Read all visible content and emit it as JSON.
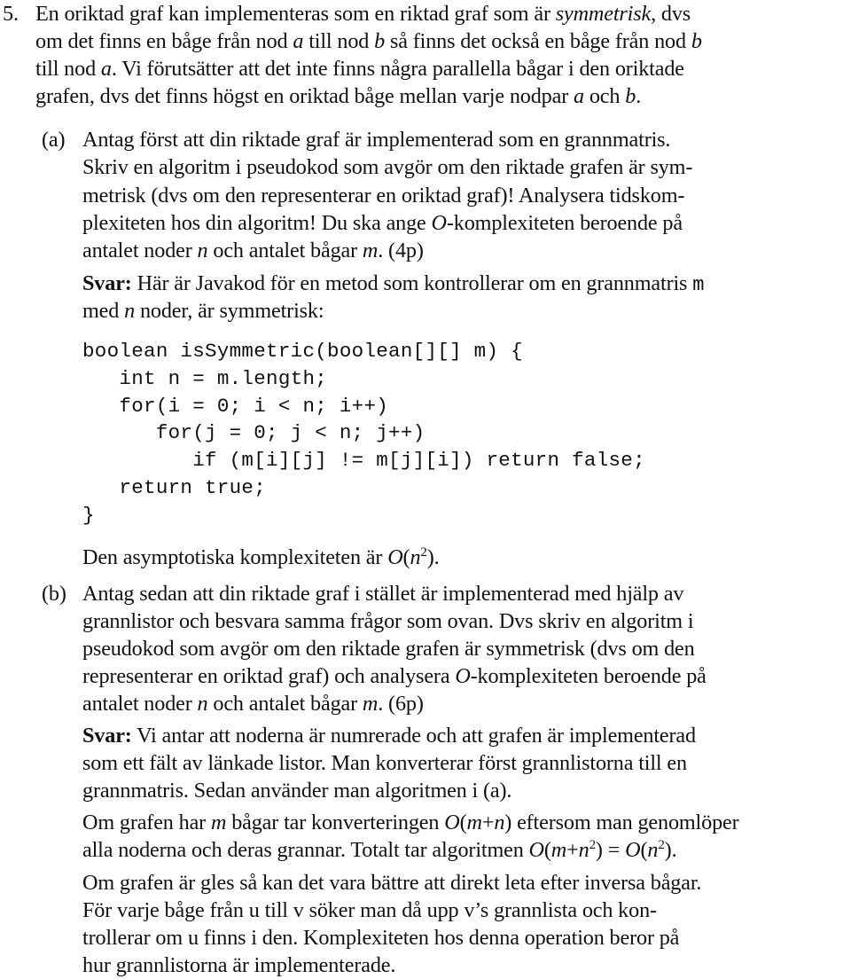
{
  "problem": {
    "number": "5.",
    "intro_lines": [
      [
        {
          "t": "En oriktad graf kan implementeras som en riktad graf som är "
        },
        {
          "t": "symmetrisk",
          "s": "i"
        },
        {
          "t": ", dvs"
        }
      ],
      [
        {
          "t": "om det finns en båge från nod "
        },
        {
          "t": "a",
          "s": "i"
        },
        {
          "t": " till nod "
        },
        {
          "t": "b",
          "s": "i"
        },
        {
          "t": " så finns det också en båge från nod "
        },
        {
          "t": "b",
          "s": "i"
        }
      ],
      [
        {
          "t": "till nod "
        },
        {
          "t": "a",
          "s": "i"
        },
        {
          "t": ". Vi förutsätter att det inte finns några parallella bågar i den oriktade"
        }
      ],
      [
        {
          "t": "grafen, dvs det finns högst en oriktad båge mellan varje nodpar "
        },
        {
          "t": "a",
          "s": "i"
        },
        {
          "t": " och "
        },
        {
          "t": "b",
          "s": "i"
        },
        {
          "t": "."
        }
      ]
    ]
  },
  "part_a": {
    "label": "(a)",
    "question_lines": [
      [
        {
          "t": "Antag först att din riktade graf är implementerad som en grannmatris."
        }
      ],
      [
        {
          "t": "Skriv en algoritm i pseudokod som avgör om den riktade grafen är sym-"
        }
      ],
      [
        {
          "t": "metrisk (dvs om den representerar en oriktad graf)! Analysera tidskom-"
        }
      ],
      [
        {
          "t": "plexiteten hos din algoritm! Du ska ange "
        },
        {
          "t": "O",
          "s": "i"
        },
        {
          "t": "-komplexiteten beroende på"
        }
      ],
      [
        {
          "t": "antalet noder "
        },
        {
          "t": "n",
          "s": "i"
        },
        {
          "t": " och antalet bågar "
        },
        {
          "t": "m",
          "s": "i"
        },
        {
          "t": ". (4p)"
        }
      ]
    ],
    "answer_lines": [
      [
        {
          "t": "Svar:",
          "s": "b"
        },
        {
          "t": " Här är Javakod för en metod som kontrollerar om en grannmatris "
        },
        {
          "t": "m",
          "s": "tt"
        }
      ],
      [
        {
          "t": "med "
        },
        {
          "t": "n",
          "s": "i"
        },
        {
          "t": " noder, är symmetrisk:"
        }
      ]
    ],
    "code_lines": [
      "boolean isSymmetric(boolean[][] m) {",
      "   int n = m.length;",
      "   for(i = 0; i < n; i++)",
      "      for(j = 0; j < n; j++)",
      "         if (m[i][j] != m[j][i]) return false;",
      "   return true;",
      "}"
    ],
    "complexity_line": [
      {
        "t": "Den asymptotiska komplexiteten är "
      },
      {
        "t": "O",
        "s": "i"
      },
      {
        "t": "("
      },
      {
        "t": "n",
        "s": "i"
      },
      {
        "t": "2",
        "s": "sup"
      },
      {
        "t": ")."
      }
    ]
  },
  "part_b": {
    "label": "(b)",
    "question_lines": [
      [
        {
          "t": "Antag sedan att din riktade graf i stället är implementerad med hjälp av"
        }
      ],
      [
        {
          "t": "grannlistor och besvara samma frågor som ovan. Dvs skriv en algoritm i"
        }
      ],
      [
        {
          "t": "pseudokod som avgör om den riktade grafen är symmetrisk (dvs om den"
        }
      ],
      [
        {
          "t": "representerar en oriktad graf) och analysera "
        },
        {
          "t": "O",
          "s": "i"
        },
        {
          "t": "-komplexiteten beroende på"
        }
      ],
      [
        {
          "t": "antalet noder "
        },
        {
          "t": "n",
          "s": "i"
        },
        {
          "t": " och antalet bågar "
        },
        {
          "t": "m",
          "s": "i"
        },
        {
          "t": ". (6p)"
        }
      ]
    ],
    "answer_lines": [
      [
        {
          "t": "Svar:",
          "s": "b"
        },
        {
          "t": "  Vi antar att noderna är numrerade och att grafen är implementerad"
        }
      ],
      [
        {
          "t": "som ett fält av länkade listor. Man konverterar först grannlistorna till en"
        }
      ],
      [
        {
          "t": "grannmatris. Sedan använder man algoritmen i (a)."
        }
      ]
    ],
    "conversion_lines": [
      [
        {
          "t": "Om grafen har "
        },
        {
          "t": "m",
          "s": "i"
        },
        {
          "t": " bågar tar konverteringen "
        },
        {
          "t": "O",
          "s": "i"
        },
        {
          "t": "("
        },
        {
          "t": "m",
          "s": "i"
        },
        {
          "t": "+"
        },
        {
          "t": "n",
          "s": "i"
        },
        {
          "t": ") eftersom man genomlöper"
        }
      ],
      [
        {
          "t": "alla noderna och deras grannar. Totalt tar algoritmen "
        },
        {
          "t": "O",
          "s": "i"
        },
        {
          "t": "("
        },
        {
          "t": "m",
          "s": "i"
        },
        {
          "t": "+"
        },
        {
          "t": "n",
          "s": "i"
        },
        {
          "t": "2",
          "s": "sup"
        },
        {
          "t": ") = "
        },
        {
          "t": "O",
          "s": "i"
        },
        {
          "t": "("
        },
        {
          "t": "n",
          "s": "i"
        },
        {
          "t": "2",
          "s": "sup"
        },
        {
          "t": ")."
        }
      ]
    ],
    "sparse_lines": [
      [
        {
          "t": "Om grafen är gles så kan det vara bättre att direkt leta efter inversa bågar."
        }
      ],
      [
        {
          "t": "För varje båge från u till v söker man då upp v’s grannlista och kon-"
        }
      ],
      [
        {
          "t": "trollerar om u finns i den. Komplexiteten hos denna operation beror på"
        }
      ],
      [
        {
          "t": "hur grannlistorna är implementerade."
        }
      ]
    ]
  }
}
